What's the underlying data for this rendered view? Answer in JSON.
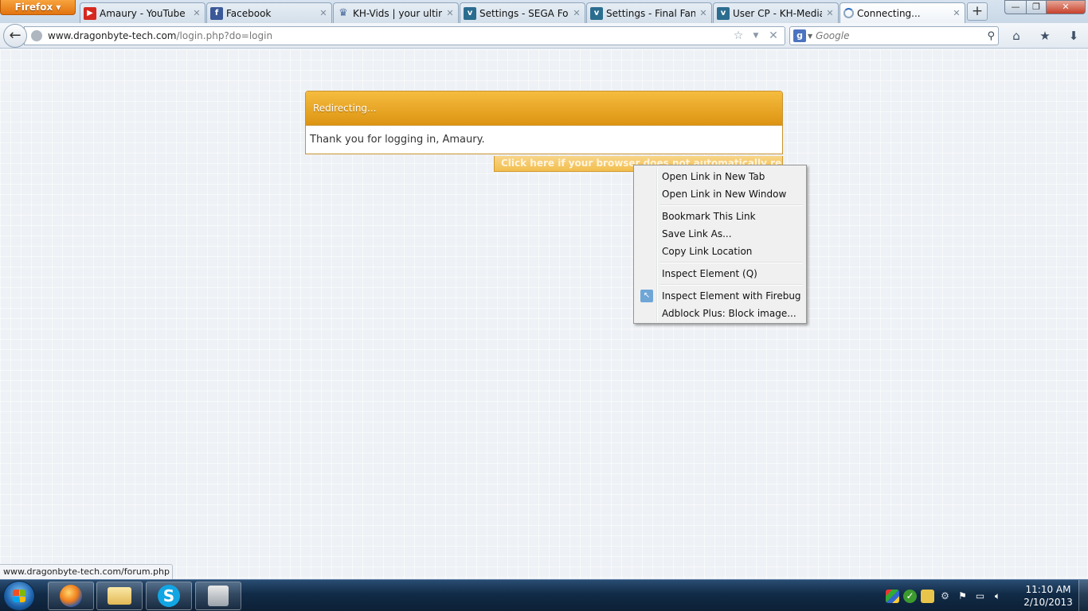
{
  "browser": {
    "app_button_label": "Firefox",
    "tabs": [
      {
        "title": "Amaury - YouTube",
        "icon": "youtube-icon"
      },
      {
        "title": "Facebook",
        "icon": "facebook-icon"
      },
      {
        "title": "KH-Vids | your ultim...",
        "icon": "kh-vids-icon"
      },
      {
        "title": "Settings - SEGA For...",
        "icon": "vbulletin-icon"
      },
      {
        "title": "Settings - Final Fant...",
        "icon": "vbulletin-icon"
      },
      {
        "title": "User CP - KH-Media...",
        "icon": "vbulletin-icon"
      },
      {
        "title": "Connecting...",
        "icon": "loading-spinner-icon"
      }
    ],
    "new_tab_label": "+",
    "url_domain": "www.dragonbyte-tech.com",
    "url_path": "/login.php?do=login",
    "search_placeholder": "Google",
    "search_engine_letter": "g"
  },
  "page": {
    "redirect_title": "Redirecting...",
    "redirect_message": "Thank you for logging in, Amaury.",
    "redirect_link_text": "Click here if your browser does not automatically redirect you."
  },
  "context_menu": {
    "items": [
      {
        "label": "Open Link in New Tab"
      },
      {
        "label": "Open Link in New Window"
      },
      {
        "label": "Bookmark This Link"
      },
      {
        "label": "Save Link As..."
      },
      {
        "label": "Copy Link Location"
      },
      {
        "label": "Inspect Element (Q)"
      },
      {
        "label": "Inspect Element with Firebug",
        "icon": "firebug-inspect-icon"
      },
      {
        "label": "Adblock Plus: Block image..."
      }
    ]
  },
  "status_bar": {
    "text": "www.dragonbyte-tech.com/forum.php"
  },
  "taskbar": {
    "clock_time": "11:10 AM",
    "clock_date": "2/10/2013",
    "skype_letter": "S"
  }
}
